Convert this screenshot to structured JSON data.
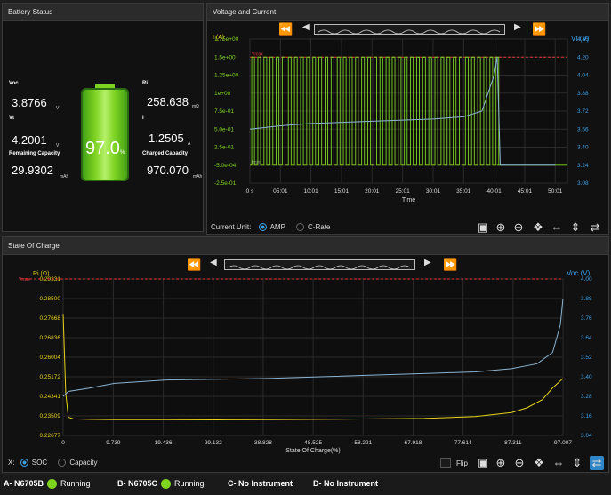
{
  "battery_panel": {
    "title": "Battery Status",
    "voc_label": "Voc",
    "voc_value": "3.8766",
    "voc_unit": "V",
    "vt_label": "Vt",
    "vt_value": "4.2001",
    "vt_unit": "V",
    "rc_label": "Remaining Capacity",
    "rc_value": "29.9302",
    "rc_unit": "mAh",
    "ri_label": "Ri",
    "ri_value": "258.638",
    "ri_unit": "mΩ",
    "i_label": "I",
    "i_value": "1.2505",
    "i_unit": "A",
    "cc_label": "Charged Capacity",
    "cc_value": "970.070",
    "cc_unit": "mAh",
    "percent": "97.0",
    "percent_unit": "%"
  },
  "vc_panel": {
    "title": "Voltage and Current",
    "current_unit_label": "Current Unit:",
    "option_amp": "AMP",
    "option_crate": "C-Rate"
  },
  "soc_panel": {
    "title": "State Of Charge",
    "x_label": "X:",
    "option_soc": "SOC",
    "option_capacity": "Capacity",
    "flip_label": "Flip"
  },
  "status_bar": {
    "a": "A- N6705B",
    "a_state": "Running",
    "b": "B- N6705C",
    "b_state": "Running",
    "c": "C- No Instrument",
    "d": "D- No Instrument"
  },
  "colors": {
    "accent": "#3aa0e8",
    "green": "#7ed321",
    "yellow": "#e6d21a",
    "blue": "#8ab4d4",
    "red": "#d33"
  },
  "chart_data": [
    {
      "type": "line",
      "title": "",
      "xlabel": "Time",
      "ylabel_left": "I (A)",
      "ylabel_right": "Vt (V)",
      "x_ticks": [
        "0 s",
        "05:01",
        "10:01",
        "15:01",
        "20:01",
        "25:01",
        "30:01",
        "35:01",
        "40:01",
        "45:01",
        "50:01"
      ],
      "y_left_ticks": [
        "1.75e+00",
        "1.5e+00",
        "1.25e+00",
        "1e+00",
        "7.5e-01",
        "5.0e-01",
        "2.5e-01",
        "-5.0e-04",
        "-2.5e-01"
      ],
      "y_right_ticks": [
        "4.36",
        "4.20",
        "4.04",
        "3.88",
        "3.72",
        "3.56",
        "3.40",
        "3.24",
        "3.08"
      ],
      "ylim_left": [
        -0.25,
        1.75
      ],
      "ylim_right": [
        3.08,
        4.36
      ],
      "markers": [
        "Vmax",
        "Imin"
      ],
      "series": [
        {
          "name": "I",
          "color": "#7ed321",
          "description_values": {
            "pulse_high": 1.5,
            "pulse_low": -0.0005,
            "pulse_period_min": 1.0,
            "end_time": "40:30"
          }
        },
        {
          "name": "Vt",
          "color": "#8ab4d4",
          "x": [
            0,
            5,
            10,
            15,
            20,
            25,
            30,
            35,
            38,
            40,
            40.5,
            41,
            50
          ],
          "values": [
            3.56,
            3.59,
            3.61,
            3.62,
            3.63,
            3.64,
            3.65,
            3.67,
            3.72,
            4.04,
            4.2,
            3.24,
            3.24
          ]
        }
      ]
    },
    {
      "type": "line",
      "title": "",
      "xlabel": "State Of Charge(%)",
      "ylabel_left": "Ri (Ω)",
      "ylabel_right": "Voc (V)",
      "x_ticks": [
        "0",
        "9.739",
        "19.436",
        "29.132",
        "38.828",
        "48.525",
        "58.221",
        "67.918",
        "77.614",
        "87.311",
        "97.007"
      ],
      "y_left_ticks": [
        "0.29331",
        "0.28500",
        "0.27668",
        "0.26836",
        "0.26004",
        "0.25172",
        "0.24341",
        "0.23509",
        "0.22677"
      ],
      "y_right_ticks": [
        "4.00",
        "3.88",
        "3.76",
        "3.64",
        "3.52",
        "3.40",
        "3.28",
        "3.16",
        "3.04"
      ],
      "ylim_left": [
        0.22677,
        0.29331
      ],
      "ylim_right": [
        3.04,
        4.0
      ],
      "markers": [
        "Vmax"
      ],
      "series": [
        {
          "name": "Ri",
          "color": "#e6d21a",
          "x": [
            0,
            0.5,
            1,
            2,
            5,
            10,
            20,
            30,
            40,
            50,
            60,
            70,
            80,
            87,
            90,
            93,
            95,
            97
          ],
          "values": [
            0.2785,
            0.245,
            0.2345,
            0.2338,
            0.2336,
            0.2335,
            0.2335,
            0.2334,
            0.2335,
            0.2336,
            0.2338,
            0.234,
            0.2348,
            0.2365,
            0.2385,
            0.242,
            0.247,
            0.251
          ]
        },
        {
          "name": "Voc",
          "color": "#8ab4d4",
          "x": [
            0,
            1,
            5,
            10,
            20,
            30,
            40,
            50,
            60,
            70,
            80,
            87,
            92,
            95,
            96.5,
            97
          ],
          "values": [
            3.28,
            3.31,
            3.33,
            3.36,
            3.38,
            3.385,
            3.39,
            3.4,
            3.41,
            3.42,
            3.43,
            3.45,
            3.48,
            3.55,
            3.72,
            3.88
          ]
        }
      ]
    }
  ]
}
